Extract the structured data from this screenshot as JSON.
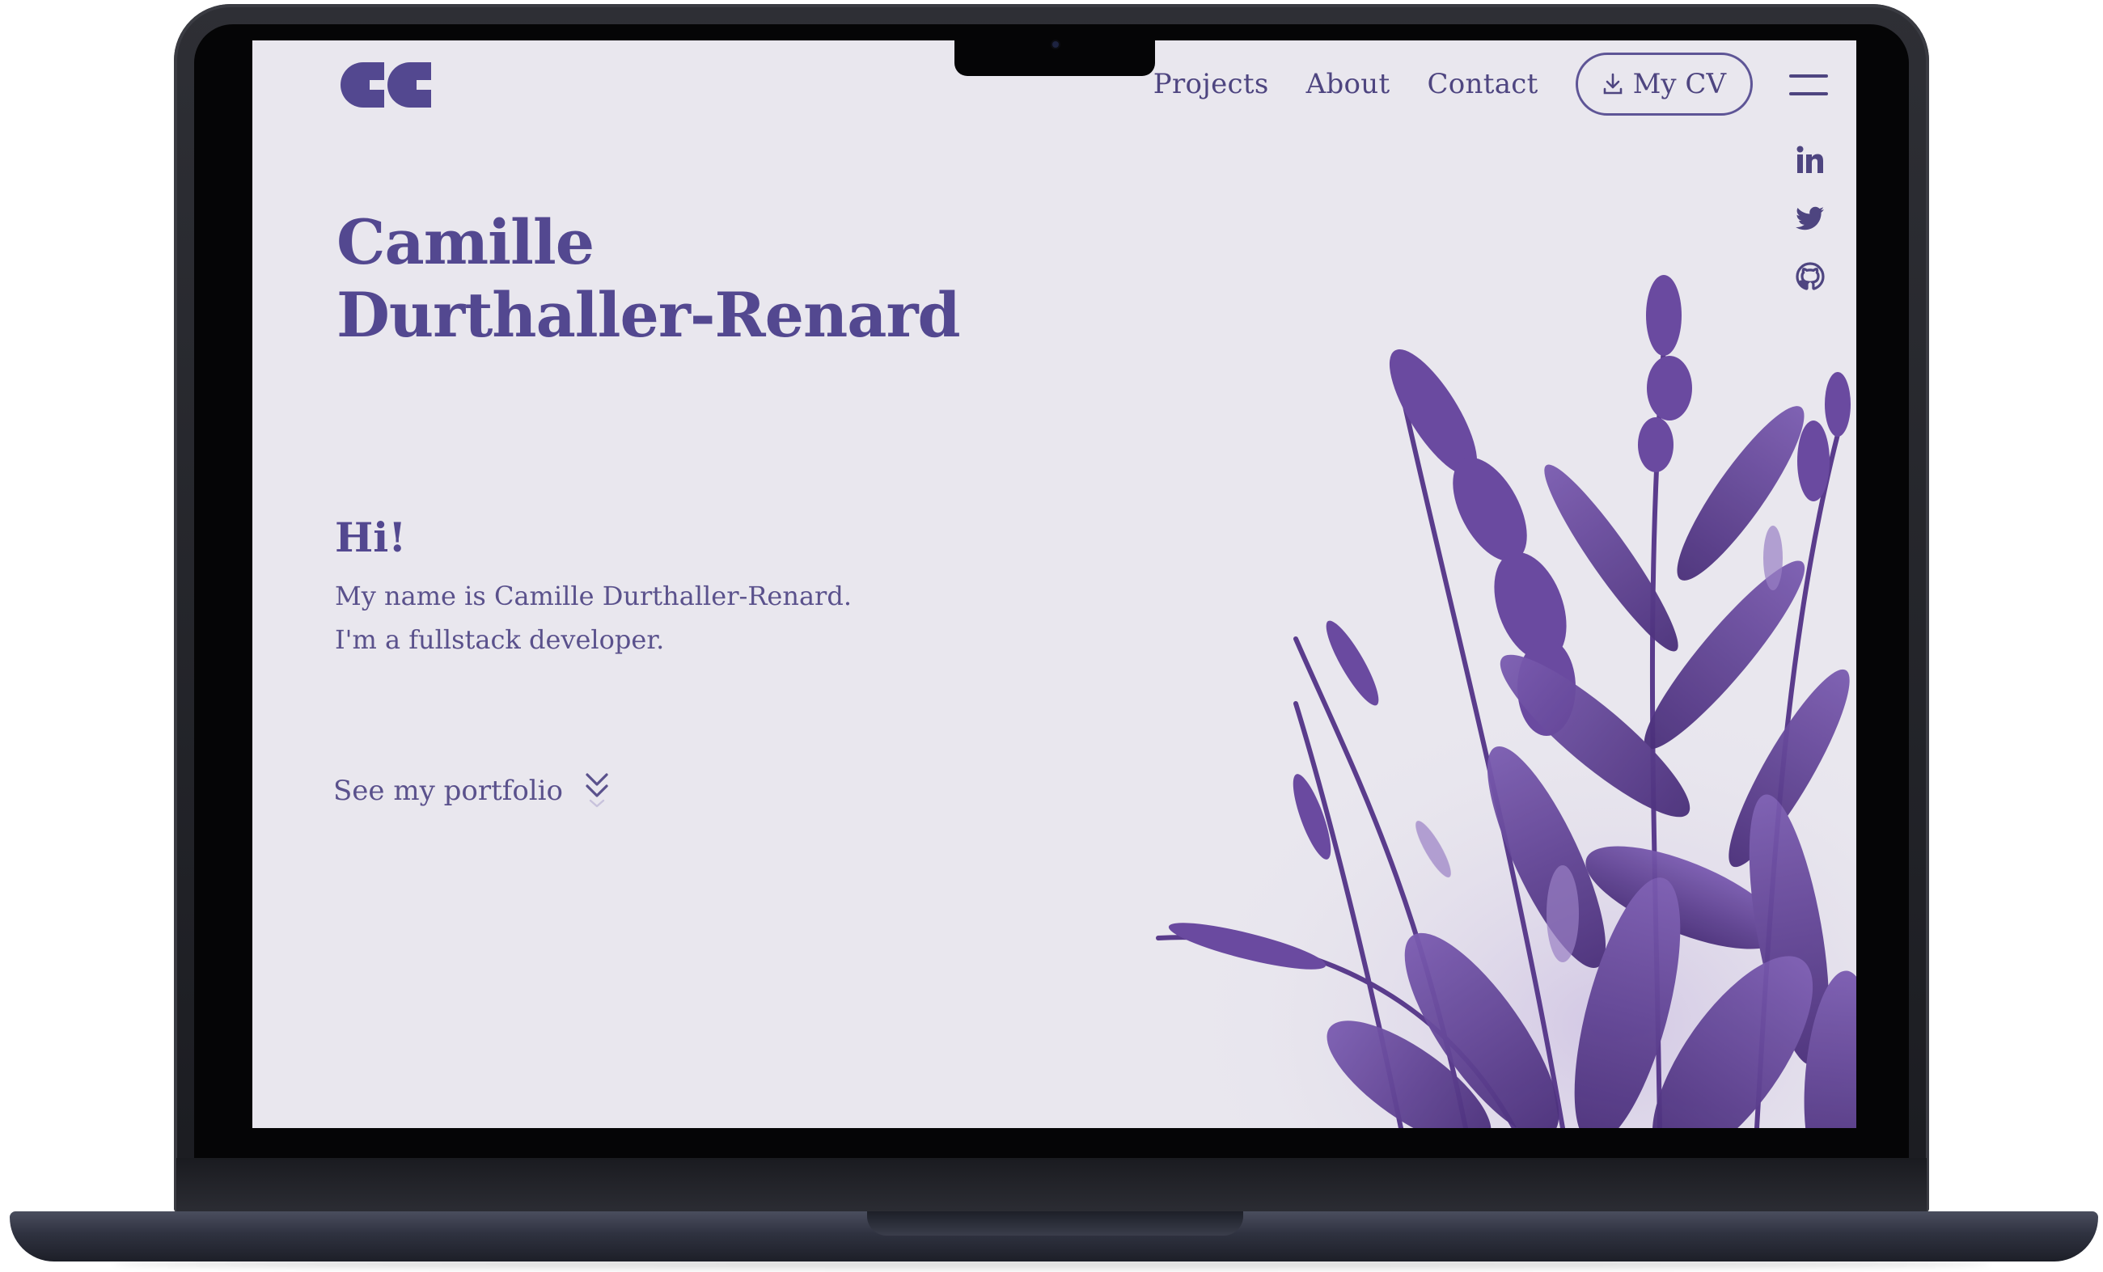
{
  "page": {
    "owner_name": "Camille Durthaller-Renard"
  },
  "nav": {
    "links": [
      {
        "label": "Projects"
      },
      {
        "label": "About"
      },
      {
        "label": "Contact"
      }
    ],
    "cv_button_label": "My CV",
    "menu_icon": "hamburger-menu-icon",
    "cv_icon": "download-icon"
  },
  "header": {
    "logo_icon": "cc-monogram-logo"
  },
  "socials": [
    {
      "icon": "linkedin-icon"
    },
    {
      "icon": "twitter-icon"
    },
    {
      "icon": "github-icon"
    }
  ],
  "hero": {
    "title_line1": "Camille",
    "title_line2": "Durthaller-Renard",
    "greeting": "Hi!",
    "intro_line1": "My name is Camille Durthaller-Renard.",
    "intro_line2": "I'm a fullstack developer.",
    "portfolio_link": "See my portfolio",
    "portfolio_icon": "double-chevron-down-icon",
    "illustration": "purple-lavender-plants"
  },
  "colors": {
    "accent": "#534890",
    "background": "#e9e7ee",
    "plant_dark": "#4a2f7a",
    "plant_mid": "#6b4b9e",
    "plant_light": "#9a80c4"
  }
}
